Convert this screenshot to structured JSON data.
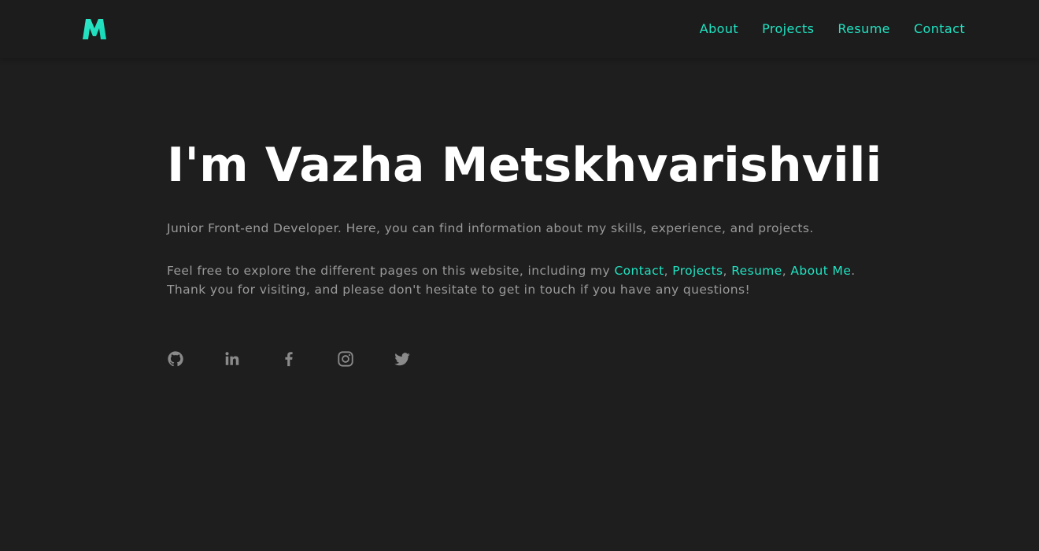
{
  "logo": {
    "letter": "M",
    "color": "#20e3c2",
    "icon": "logo-m-icon"
  },
  "nav": {
    "items": [
      {
        "label": "About"
      },
      {
        "label": "Projects"
      },
      {
        "label": "Resume"
      },
      {
        "label": "Contact"
      }
    ]
  },
  "hero": {
    "title": "I'm Vazha Metskhvarishvili",
    "intro": "Junior Front-end Developer. Here, you can find information about my skills, experience, and projects.",
    "explore_prefix": "Feel free to explore the different pages on this website, including my ",
    "links": {
      "contact": "Contact",
      "projects": "Projects",
      "resume": "Resume",
      "about": "About Me"
    },
    "sep1": ", ",
    "sep2": ", ",
    "sep3": ", ",
    "explore_suffix": ".",
    "thanks": "Thank you for visiting, and please don't hesitate to get in touch if you have any questions!"
  },
  "socials": [
    {
      "icon": "github-icon"
    },
    {
      "icon": "linkedin-icon"
    },
    {
      "icon": "facebook-icon"
    },
    {
      "icon": "instagram-icon"
    },
    {
      "icon": "twitter-icon"
    }
  ],
  "colors": {
    "background": "#1e1e1e",
    "navbar": "#1c1c1c",
    "accent": "#20e3c2",
    "text_muted": "#9a9a9a",
    "icon": "#8a8a8a",
    "title": "#ffffff"
  }
}
